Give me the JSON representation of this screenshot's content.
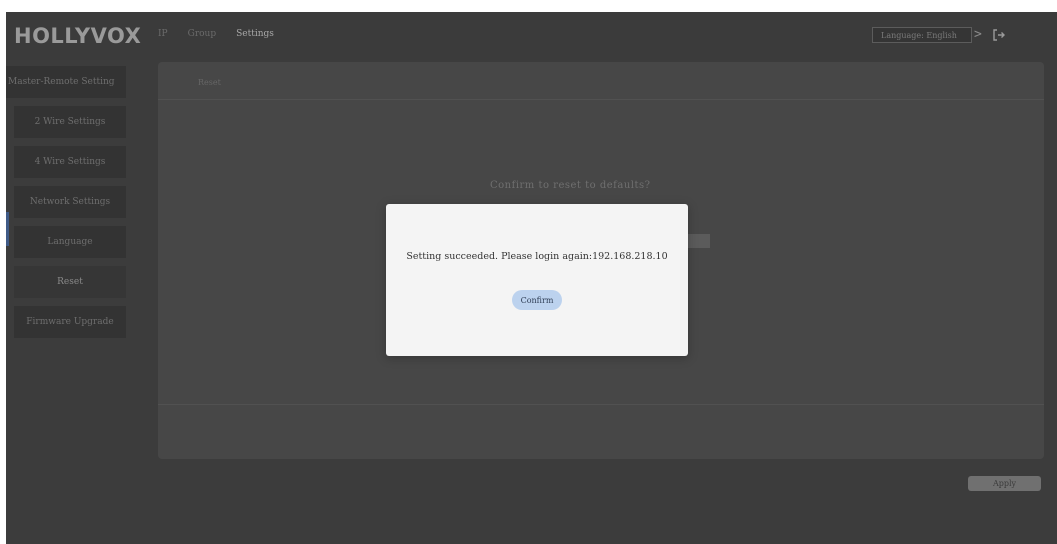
{
  "app": {
    "logo": "HOLLYVOX"
  },
  "topbar": {
    "nav": [
      {
        "label": "IP",
        "active": false
      },
      {
        "label": "Group",
        "active": false
      },
      {
        "label": "Settings",
        "active": true
      }
    ],
    "language_label": "Language: English",
    "arrow": ">"
  },
  "sidebar": {
    "items": [
      {
        "label": "Master-Remote Setting"
      },
      {
        "label": "2 Wire Settings"
      },
      {
        "label": "4 Wire Settings"
      },
      {
        "label": "Network Settings"
      },
      {
        "label": "Language"
      },
      {
        "label": "Reset"
      },
      {
        "label": "Firmware Upgrade"
      }
    ],
    "selected_index": 5
  },
  "panel": {
    "tab_label": "Reset",
    "confirm_question": "Confirm to reset to defaults?"
  },
  "footer": {
    "apply_label": "Apply"
  },
  "modal": {
    "message": "Setting succeeded. Please login again:192.168.218.10",
    "confirm_label": "Confirm"
  },
  "colors": {
    "background": "#3c3c3c",
    "modal_background": "#f4f4f4",
    "modal_button": "#bcd2ee",
    "active_marker": "#3f5a86"
  },
  "icons": {
    "logout": "logout-icon",
    "language_arrow": "chevron-right-icon"
  }
}
